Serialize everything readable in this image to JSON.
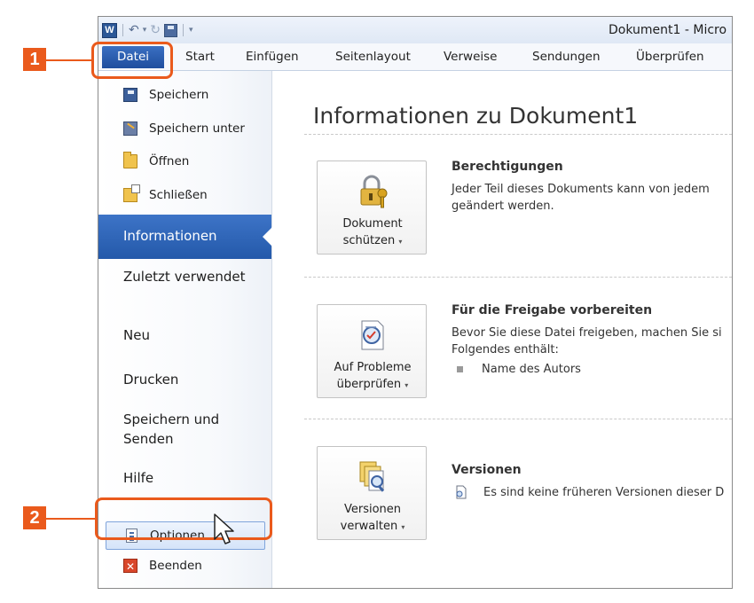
{
  "titlebar": {
    "doc_title": "Dokument1 - Micro",
    "app_logo": "W"
  },
  "tabs": {
    "datei": "Datei",
    "items": [
      "Start",
      "Einfügen",
      "Seitenlayout",
      "Verweise",
      "Sendungen",
      "Überprüfen"
    ]
  },
  "nav": {
    "speichern": "Speichern",
    "speichern_unter": "Speichern unter",
    "oeffnen": "Öffnen",
    "schliessen": "Schließen",
    "informationen": "Informationen",
    "zuletzt_verwendet": "Zuletzt verwendet",
    "neu": "Neu",
    "drucken": "Drucken",
    "speichern_senden": "Speichern und Senden",
    "hilfe": "Hilfe",
    "optionen": "Optionen",
    "beenden": "Beenden"
  },
  "main": {
    "title": "Informationen zu Dokument1",
    "sections": {
      "berechtigungen": {
        "button_line1": "Dokument",
        "button_line2": "schützen",
        "title": "Berechtigungen",
        "line1": "Jeder Teil dieses Dokuments kann von jedem",
        "line2": "geändert werden."
      },
      "freigabe": {
        "button_line1": "Auf Probleme",
        "button_line2": "überprüfen",
        "title": "Für die Freigabe vorbereiten",
        "line1": "Bevor Sie diese Datei freigeben, machen Sie si",
        "line2": "Folgendes enthält:",
        "bullet": "Name des Autors"
      },
      "versionen": {
        "button_line1": "Versionen",
        "button_line2": "verwalten",
        "title": "Versionen",
        "line1": "Es sind keine früheren Versionen dieser D"
      }
    }
  },
  "callouts": {
    "one": "1",
    "two": "2"
  },
  "colors": {
    "accent": "#2459aa",
    "callout": "#ea5a1c"
  }
}
